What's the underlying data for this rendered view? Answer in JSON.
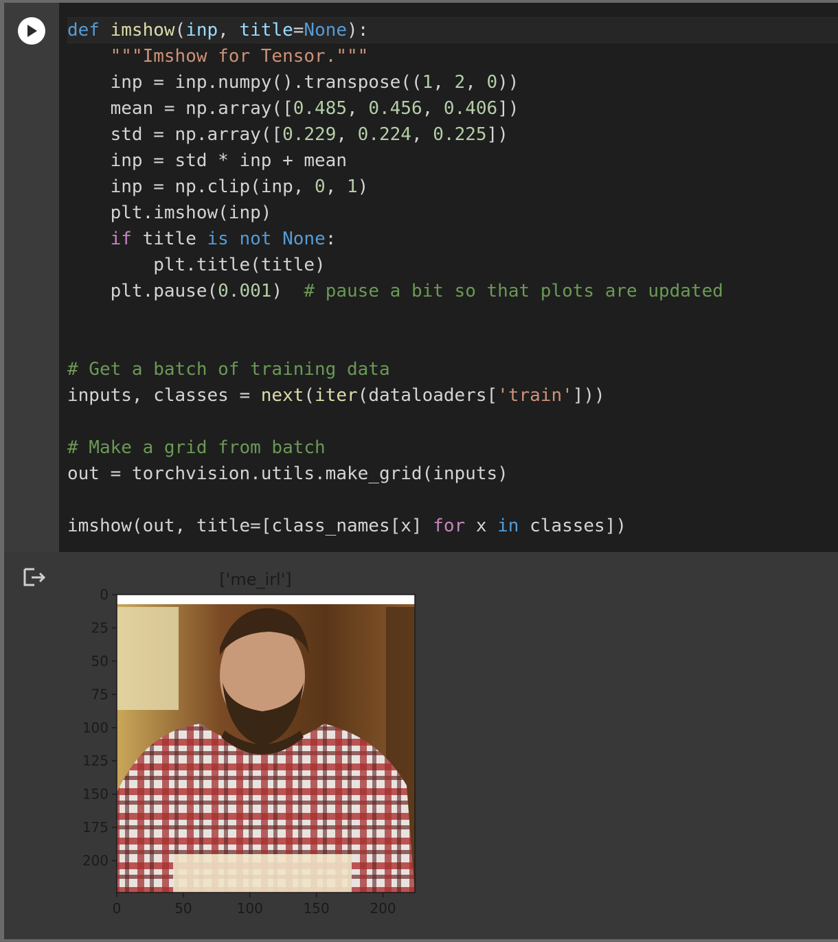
{
  "cell": {
    "run_button_label": "",
    "code_lines": [
      [
        [
          "kw",
          "def"
        ],
        [
          "t",
          " "
        ],
        [
          "fn",
          "imshow"
        ],
        [
          "t",
          "("
        ],
        [
          "pr",
          "inp"
        ],
        [
          "t",
          ", "
        ],
        [
          "pr",
          "title"
        ],
        [
          "t",
          "="
        ],
        [
          "kw",
          "None"
        ],
        [
          "t",
          "):"
        ]
      ],
      [
        [
          "t",
          "    "
        ],
        [
          "str",
          "\"\"\"Imshow for Tensor.\"\"\""
        ]
      ],
      [
        [
          "t",
          "    inp = inp.numpy().transpose(("
        ],
        [
          "num",
          "1"
        ],
        [
          "t",
          ", "
        ],
        [
          "num",
          "2"
        ],
        [
          "t",
          ", "
        ],
        [
          "num",
          "0"
        ],
        [
          "t",
          "))"
        ]
      ],
      [
        [
          "t",
          "    mean = np.array(["
        ],
        [
          "num",
          "0.485"
        ],
        [
          "t",
          ", "
        ],
        [
          "num",
          "0.456"
        ],
        [
          "t",
          ", "
        ],
        [
          "num",
          "0.406"
        ],
        [
          "t",
          "])"
        ]
      ],
      [
        [
          "t",
          "    std = np.array(["
        ],
        [
          "num",
          "0.229"
        ],
        [
          "t",
          ", "
        ],
        [
          "num",
          "0.224"
        ],
        [
          "t",
          ", "
        ],
        [
          "num",
          "0.225"
        ],
        [
          "t",
          "])"
        ]
      ],
      [
        [
          "t",
          "    inp = std * inp + mean"
        ]
      ],
      [
        [
          "t",
          "    inp = np.clip(inp, "
        ],
        [
          "num",
          "0"
        ],
        [
          "t",
          ", "
        ],
        [
          "num",
          "1"
        ],
        [
          "t",
          ")"
        ]
      ],
      [
        [
          "t",
          "    plt.imshow(inp)"
        ]
      ],
      [
        [
          "t",
          "    "
        ],
        [
          "kw2",
          "if"
        ],
        [
          "t",
          " title "
        ],
        [
          "kw",
          "is"
        ],
        [
          "t",
          " "
        ],
        [
          "kw",
          "not"
        ],
        [
          "t",
          " "
        ],
        [
          "kw",
          "None"
        ],
        [
          "t",
          ":"
        ]
      ],
      [
        [
          "t",
          "        plt.title(title)"
        ]
      ],
      [
        [
          "t",
          "    plt.pause("
        ],
        [
          "num",
          "0.001"
        ],
        [
          "t",
          ")  "
        ],
        [
          "cm",
          "# pause a bit so that plots are updated"
        ]
      ],
      [],
      [],
      [
        [
          "cm",
          "# Get a batch of training data"
        ]
      ],
      [
        [
          "t",
          "inputs, classes = "
        ],
        [
          "fn",
          "next"
        ],
        [
          "t",
          "("
        ],
        [
          "fn",
          "iter"
        ],
        [
          "t",
          "(dataloaders["
        ],
        [
          "str",
          "'train'"
        ],
        [
          "t",
          "]))"
        ]
      ],
      [],
      [
        [
          "cm",
          "# Make a grid from batch"
        ]
      ],
      [
        [
          "t",
          "out = torchvision.utils.make_grid(inputs)"
        ]
      ],
      [],
      [
        [
          "t",
          "imshow(out, title=[class_names[x] "
        ],
        [
          "kw2",
          "for"
        ],
        [
          "t",
          " x "
        ],
        [
          "kw",
          "in"
        ],
        [
          "t",
          " classes])"
        ]
      ]
    ]
  },
  "output": {
    "icon": "output-redirect-icon",
    "plot_title": "['me_irl']",
    "y_ticks": [
      "0",
      "25",
      "50",
      "75",
      "100",
      "125",
      "150",
      "175",
      "200"
    ],
    "x_ticks": [
      "0",
      "50",
      "100",
      "150",
      "200"
    ],
    "image_description_icon": "photo-bearded-man-plaid-shirt"
  }
}
